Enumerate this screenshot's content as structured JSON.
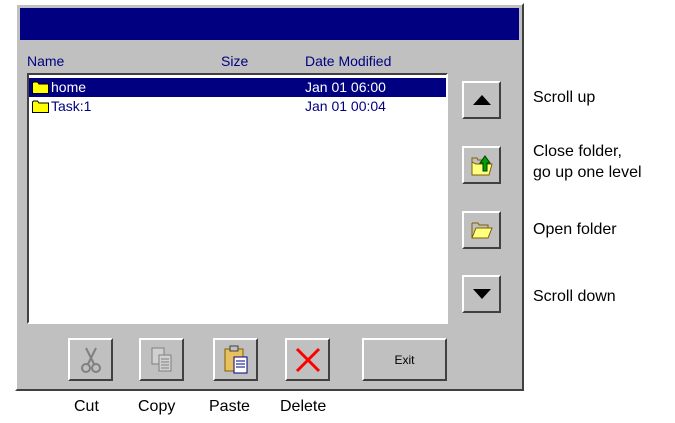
{
  "window": {
    "title": ""
  },
  "columns": {
    "name": "Name",
    "size": "Size",
    "date": "Date Modified"
  },
  "files": [
    {
      "name": "home",
      "size": "",
      "date": "Jan 01 06:00",
      "selected": true,
      "icon": "folder-icon"
    },
    {
      "name": "Task:1",
      "size": "",
      "date": "Jan 01 00:04",
      "selected": false,
      "icon": "folder-icon"
    }
  ],
  "side_labels": {
    "scroll_up": "Scroll up",
    "close_folder_1": "Close folder,",
    "close_folder_2": "go up one level",
    "open_folder": "Open folder",
    "scroll_down": "Scroll down"
  },
  "bottom": {
    "exit": "Exit"
  },
  "bottom_labels": {
    "cut": "Cut",
    "copy": "Copy",
    "paste": "Paste",
    "delete": "Delete"
  },
  "colors": {
    "title_bar": "#000080",
    "selection": "#000080",
    "window": "#c0c0c0",
    "delete": "#ff0000",
    "folder": "#ffff00"
  }
}
